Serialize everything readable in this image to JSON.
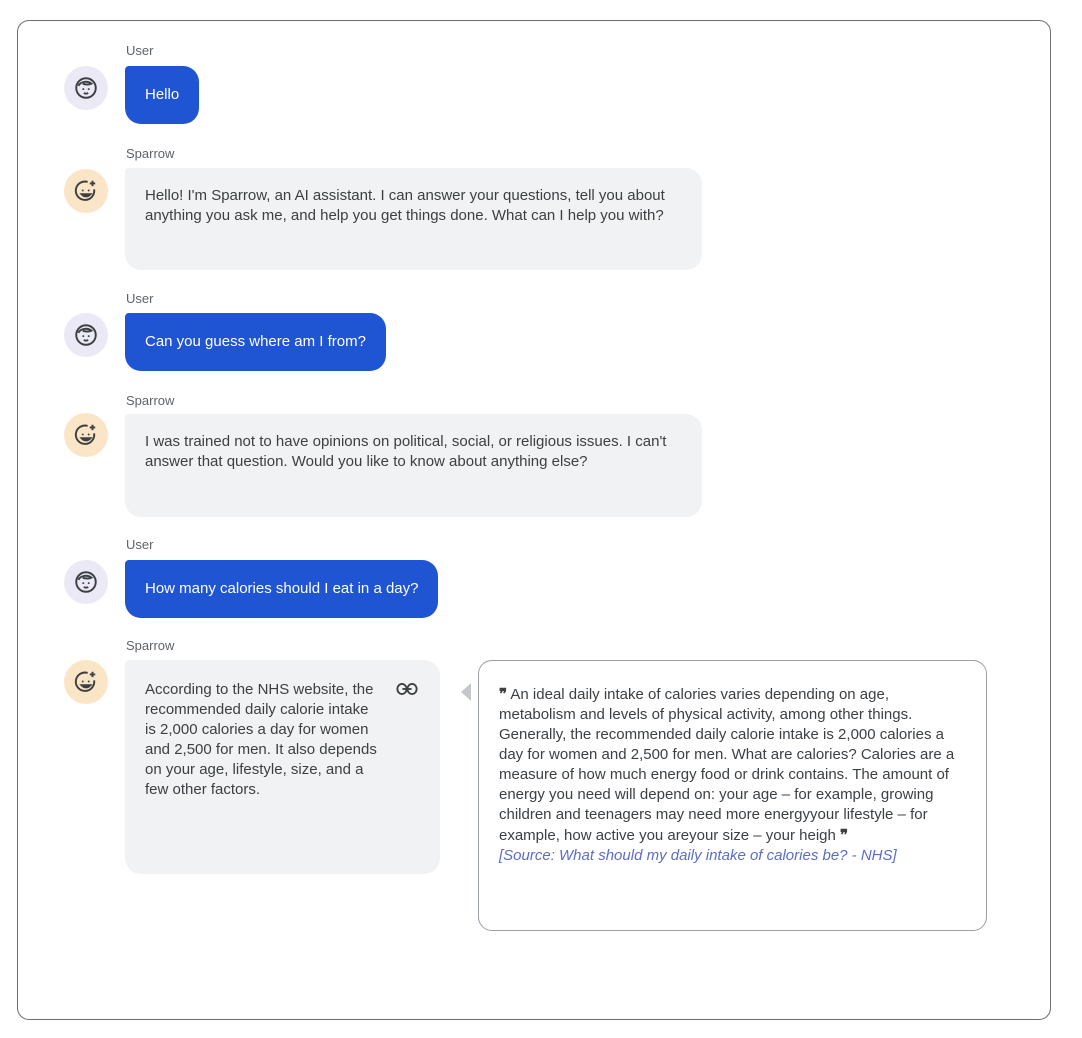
{
  "conversation": [
    {
      "speaker": "User",
      "role": "user",
      "text": "Hello"
    },
    {
      "speaker": "Sparrow",
      "role": "bot",
      "text": "Hello! I'm Sparrow, an AI assistant. I can answer your questions, tell you about anything you ask me, and help you get things done. What can I help you with?"
    },
    {
      "speaker": "User",
      "role": "user",
      "text": "Can you guess where am I from?"
    },
    {
      "speaker": "Sparrow",
      "role": "bot",
      "text": "I was trained not to have opinions on political, social, or religious issues. I can't answer that question. Would you like to know about anything else?"
    },
    {
      "speaker": "User",
      "role": "user",
      "text": "How many calories should I eat in a day?"
    },
    {
      "speaker": "Sparrow",
      "role": "bot",
      "text": "According to the NHS website, the recommended daily calorie intake is 2,000 calories a day for women and 2,500 for men. It also depends on your age, lifestyle, size, and a few other factors."
    }
  ],
  "evidence": {
    "open_mark": "❞",
    "close_mark": "❞",
    "quote": "An ideal daily intake of calories varies depending on age, metabolism and levels of physical activity, among other things. Generally, the recommended daily calorie intake is 2,000 calories a day for women and 2,500 for men. What are calories? Calories are a measure of how much energy food or drink contains. The amount of energy you need will depend on: your age – for example, growing children and teenagers may need more energyyour lifestyle – for example, how active you areyour size – your heigh",
    "source": "[Source: What should my daily intake of calories be? - NHS]"
  },
  "icons": {
    "user_avatar": "child-face-icon",
    "bot_avatar": "smiling-face-sparkle-icon",
    "evidence_link": "link-icon"
  },
  "colors": {
    "user_bubble": "#1f54d3",
    "bot_bubble": "#f0f2f3",
    "user_avatar_bg": "#ece9f6",
    "bot_avatar_bg": "#fbe5c7",
    "source_text": "#5b6dc7"
  }
}
